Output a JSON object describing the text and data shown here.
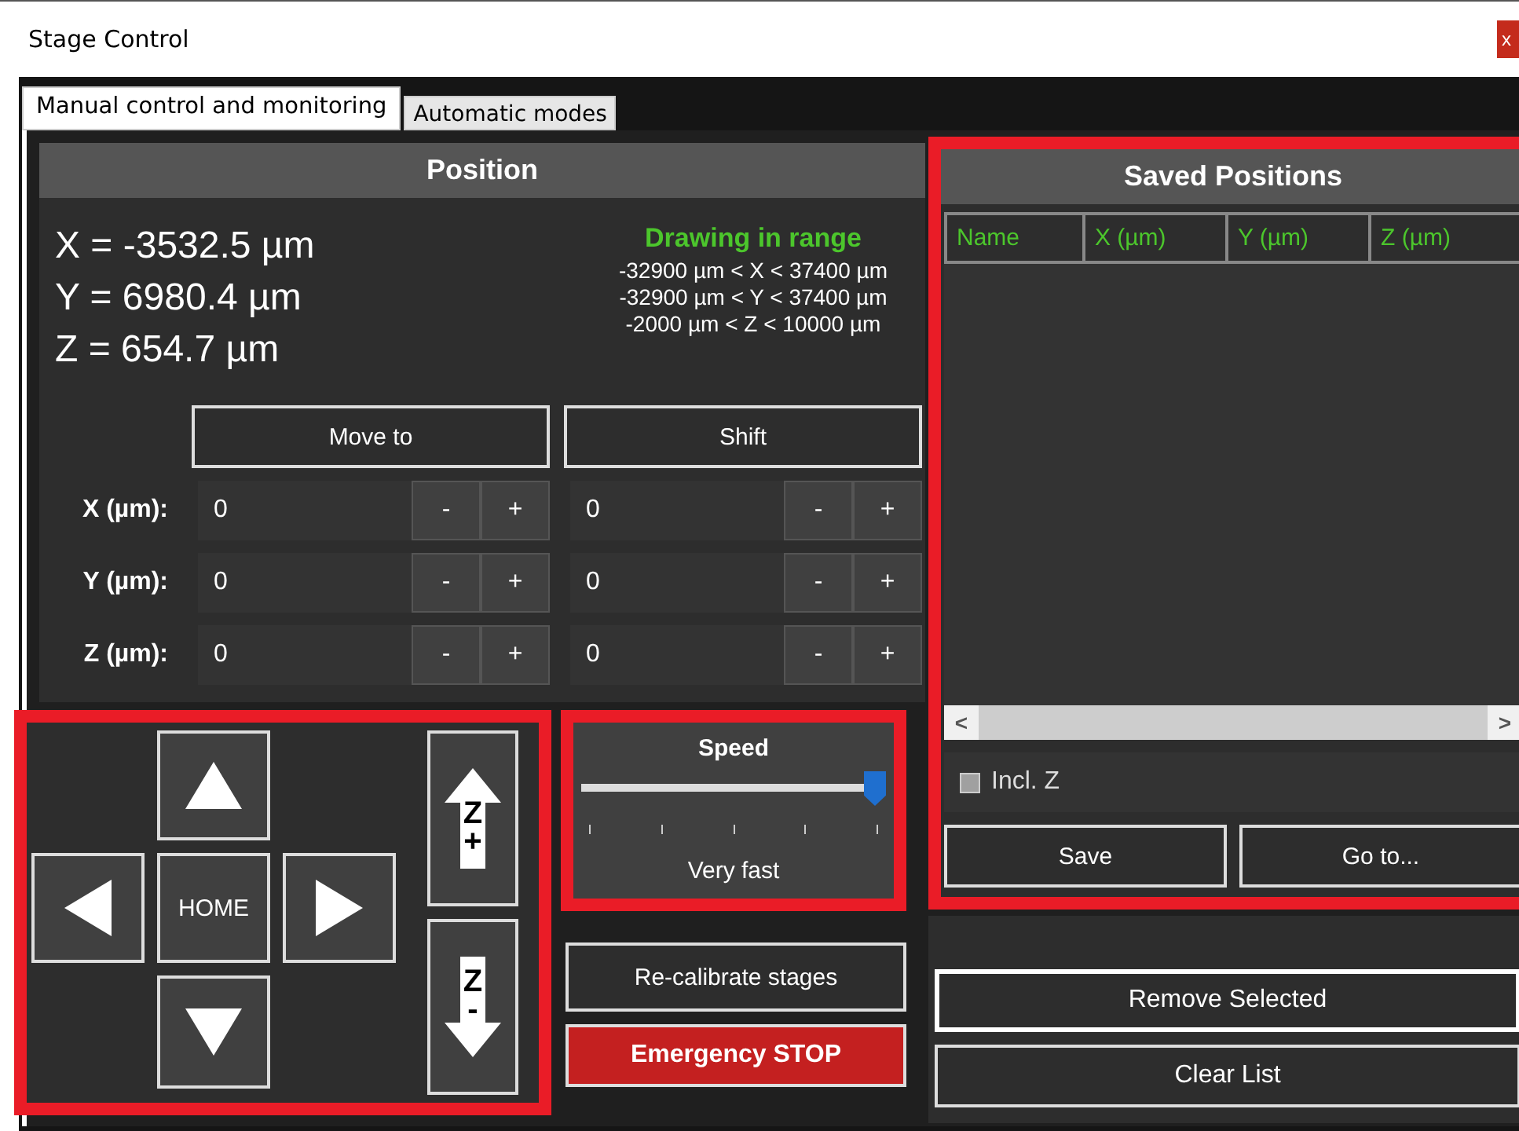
{
  "window": {
    "title": "Stage Control",
    "close": "x"
  },
  "tabs": [
    {
      "label": "Manual control and monitoring",
      "selected": true
    },
    {
      "label": "Automatic modes",
      "selected": false
    }
  ],
  "position": {
    "title": "Position",
    "readouts": [
      "X = -3532.5 µm",
      "Y = 6980.4 µm",
      "Z = 654.7 µm"
    ],
    "range_status": "Drawing in range",
    "ranges": [
      "-32900 µm < X < 37400 µm",
      "-32900 µm < Y < 37400 µm",
      "-2000 µm < Z < 10000 µm"
    ],
    "move_to": "Move to",
    "shift": "Shift",
    "rows": [
      {
        "label": "X (µm):",
        "move_value": "0",
        "shift_value": "0",
        "minus": "-",
        "plus": "+"
      },
      {
        "label": "Y (µm):",
        "move_value": "0",
        "shift_value": "0",
        "minus": "-",
        "plus": "+"
      },
      {
        "label": "Z (µm):",
        "move_value": "0",
        "shift_value": "0",
        "minus": "-",
        "plus": "+"
      }
    ]
  },
  "jog": {
    "home": "HOME",
    "z_up": {
      "letter": "Z",
      "sign": "+"
    },
    "z_down": {
      "letter": "Z",
      "sign": "-"
    }
  },
  "speed": {
    "title": "Speed",
    "level": 1.0,
    "reading": "Very fast"
  },
  "recalibrate": "Re-calibrate stages",
  "emergency_stop": "Emergency STOP",
  "saved_positions": {
    "title": "Saved Positions",
    "columns": [
      "Name",
      "X (µm)",
      "Y (µm)",
      "Z (µm)"
    ],
    "scroll_left": "<",
    "scroll_right": ">",
    "incl_z": {
      "label": "Incl. Z",
      "checked": false,
      "disabled": true
    },
    "save": "Save",
    "go_to": "Go to..."
  },
  "remove_selected": "Remove Selected",
  "clear_list": "Clear List"
}
